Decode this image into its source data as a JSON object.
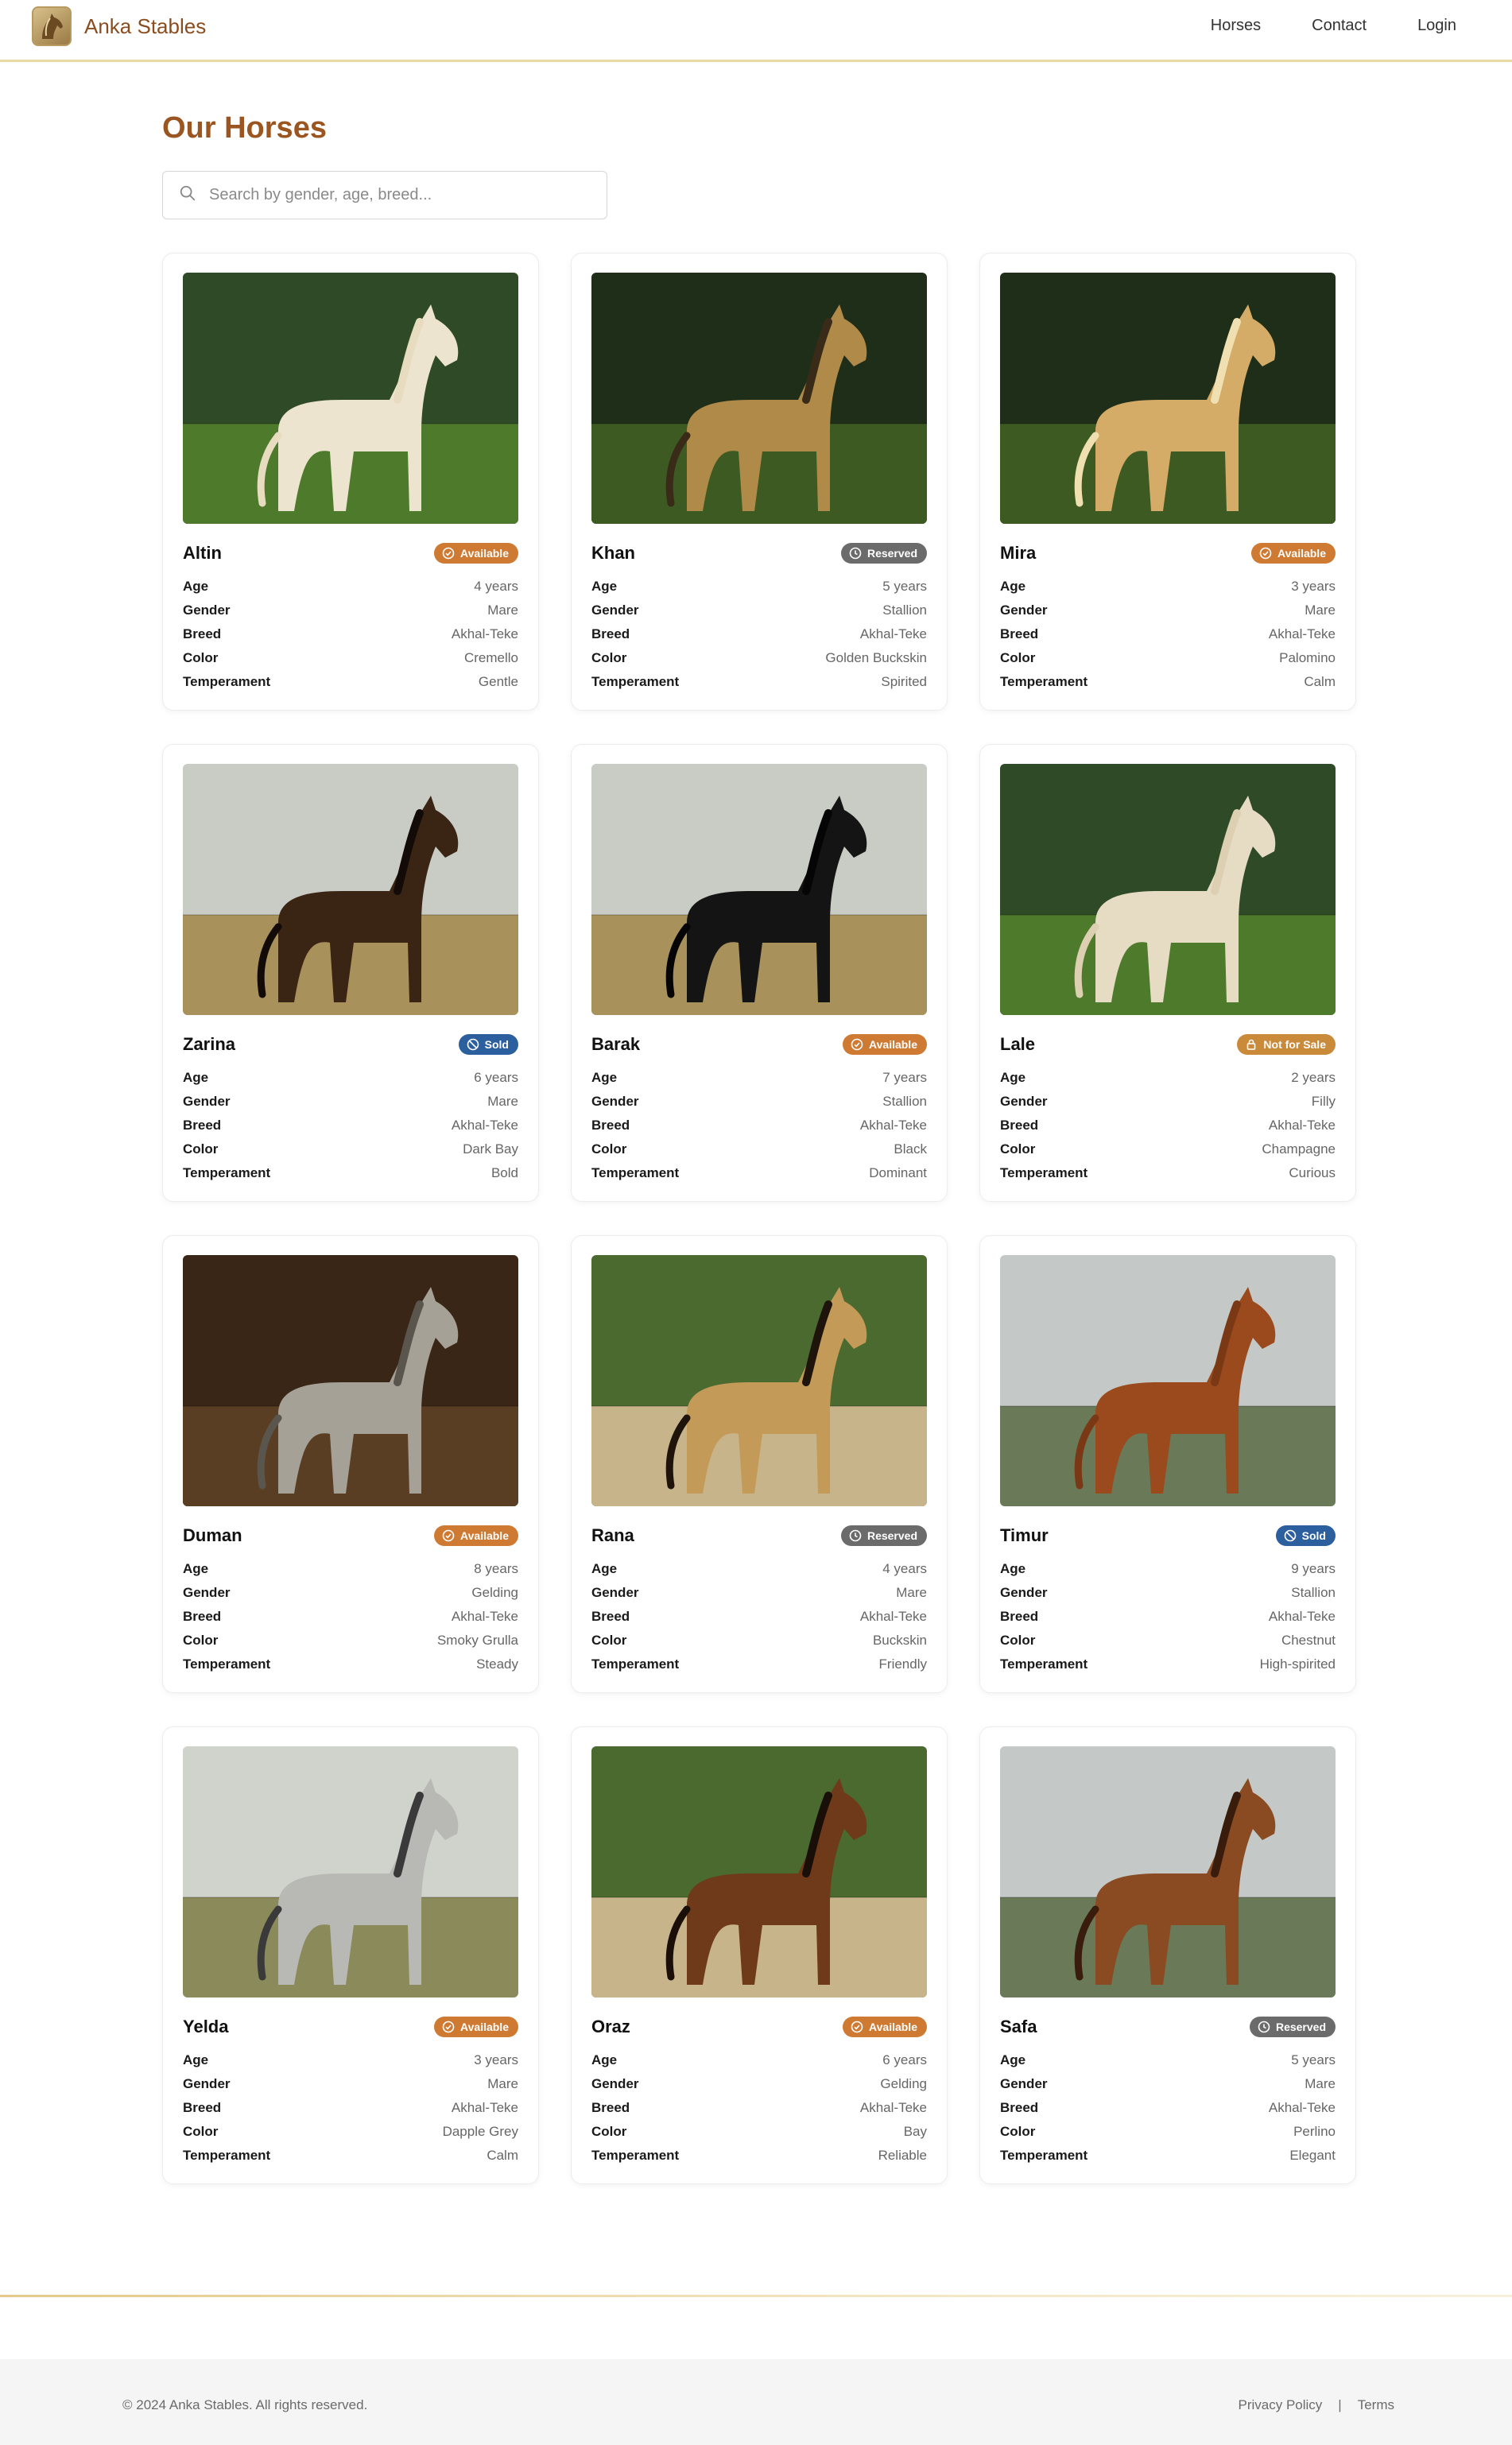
{
  "header": {
    "brand": "Anka Stables",
    "nav": [
      "Horses",
      "Contact",
      "Login"
    ]
  },
  "main": {
    "title": "Our Horses",
    "search_placeholder": "Search by gender, age, breed...",
    "spec_labels": {
      "age": "Age",
      "gender": "Gender",
      "breed": "Breed",
      "color": "Color",
      "temperament": "Temperament"
    },
    "horses": [
      {
        "name": "Altin",
        "status": "Available",
        "status_type": "available",
        "age": "4 years",
        "gender": "Mare",
        "breed": "Akhal-Teke",
        "color": "Cremello",
        "temperament": "Gentle",
        "coat": "#ece4cf",
        "mane": "#e8dcc0",
        "scene": "pasture"
      },
      {
        "name": "Khan",
        "status": "Reserved",
        "status_type": "reserved",
        "age": "5 years",
        "gender": "Stallion",
        "breed": "Akhal-Teke",
        "color": "Golden Buckskin",
        "temperament": "Spirited",
        "coat": "#b08a48",
        "mane": "#3a2a18",
        "scene": "forest"
      },
      {
        "name": "Mira",
        "status": "Available",
        "status_type": "available",
        "age": "3 years",
        "gender": "Mare",
        "breed": "Akhal-Teke",
        "color": "Palomino",
        "temperament": "Calm",
        "coat": "#d4ac68",
        "mane": "#f0dfb0",
        "scene": "forest"
      },
      {
        "name": "Zarina",
        "status": "Sold",
        "status_type": "sold",
        "age": "6 years",
        "gender": "Mare",
        "breed": "Akhal-Teke",
        "color": "Dark Bay",
        "temperament": "Bold",
        "coat": "#3a2414",
        "mane": "#120b07",
        "scene": "field"
      },
      {
        "name": "Barak",
        "status": "Available",
        "status_type": "available",
        "age": "7 years",
        "gender": "Stallion",
        "breed": "Akhal-Teke",
        "color": "Black",
        "temperament": "Dominant",
        "coat": "#141414",
        "mane": "#050505",
        "scene": "field"
      },
      {
        "name": "Lale",
        "status": "Not for Sale",
        "status_type": "notforsale",
        "age": "2 years",
        "gender": "Filly",
        "breed": "Akhal-Teke",
        "color": "Champagne",
        "temperament": "Curious",
        "coat": "#e6dcc4",
        "mane": "#ddd0b2",
        "scene": "pasture"
      },
      {
        "name": "Duman",
        "status": "Available",
        "status_type": "available",
        "age": "8 years",
        "gender": "Gelding",
        "breed": "Akhal-Teke",
        "color": "Smoky Grulla",
        "temperament": "Steady",
        "coat": "#a5a196",
        "mane": "#5a564e",
        "scene": "stable"
      },
      {
        "name": "Rana",
        "status": "Reserved",
        "status_type": "reserved",
        "age": "4 years",
        "gender": "Mare",
        "breed": "Akhal-Teke",
        "color": "Buckskin",
        "temperament": "Friendly",
        "coat": "#c49a58",
        "mane": "#1e140c",
        "scene": "arena"
      },
      {
        "name": "Timur",
        "status": "Sold",
        "status_type": "sold",
        "age": "9 years",
        "gender": "Stallion",
        "breed": "Akhal-Teke",
        "color": "Chestnut",
        "temperament": "High-spirited",
        "coat": "#9a4a1c",
        "mane": "#7a3814",
        "scene": "sky"
      },
      {
        "name": "Yelda",
        "status": "Available",
        "status_type": "available",
        "age": "3 years",
        "gender": "Mare",
        "breed": "Akhal-Teke",
        "color": "Dapple Grey",
        "temperament": "Calm",
        "coat": "#b8b8b4",
        "mane": "#3a3a3a",
        "scene": "hills"
      },
      {
        "name": "Oraz",
        "status": "Available",
        "status_type": "available",
        "age": "6 years",
        "gender": "Gelding",
        "breed": "Akhal-Teke",
        "color": "Bay",
        "temperament": "Reliable",
        "coat": "#6e3a1a",
        "mane": "#1a0f08",
        "scene": "arena"
      },
      {
        "name": "Safa",
        "status": "Reserved",
        "status_type": "reserved",
        "age": "5 years",
        "gender": "Mare",
        "breed": "Akhal-Teke",
        "color": "Perlino",
        "temperament": "Elegant",
        "coat": "#8a4a22",
        "mane": "#3a1c0c",
        "scene": "sky"
      }
    ]
  },
  "footer": {
    "copyright": "© 2024 Anka Stables. All rights reserved.",
    "links": [
      "Privacy Policy",
      "Terms"
    ],
    "separator": "|"
  }
}
